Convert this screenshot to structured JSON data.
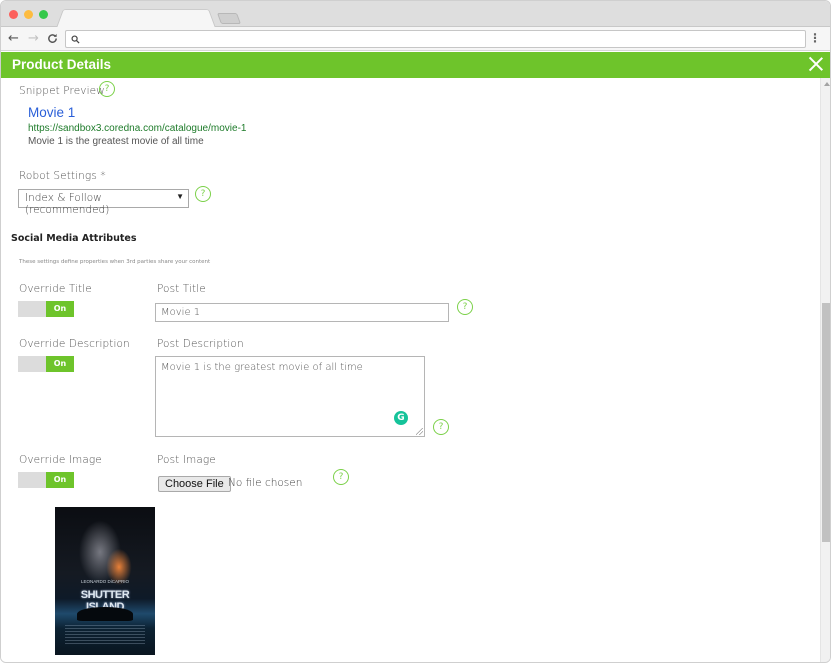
{
  "browser": {
    "tab_title": "",
    "address": "",
    "icons": {
      "back": "arrow-left-icon",
      "forward": "arrow-right-icon",
      "reload": "reload-icon",
      "search": "search-icon",
      "menu": "vertical-dots-icon"
    },
    "glyphs": {
      "back": "←",
      "forward": "→",
      "reload": "C",
      "search": "⚲",
      "menu": "⋮"
    }
  },
  "panel": {
    "title": "Product Details",
    "close_glyph": "",
    "accent_color": "#6ec42b"
  },
  "snippet": {
    "label": "Snippet Preview",
    "title": "Movie 1",
    "url": "https://sandbox3.coredna.com/catalogue/movie-1",
    "description": "Movie 1 is the greatest movie of all time"
  },
  "robot": {
    "label": "Robot Settings *",
    "selected": "Index & Follow (recommended)",
    "arrow": "▼"
  },
  "social": {
    "heading": "Social Media Attributes",
    "subheading": "These settings define properties when 3rd parties share your content",
    "override_title": {
      "label": "Override Title",
      "toggle": "On",
      "state": true
    },
    "post_title": {
      "label": "Post Title",
      "value": "Movie 1"
    },
    "override_description": {
      "label": "Override Description",
      "toggle": "On",
      "state": true
    },
    "post_description": {
      "label": "Post Description",
      "value": "Movie 1 is the greatest movie of all time"
    },
    "override_image": {
      "label": "Override Image",
      "toggle": "On",
      "state": true
    },
    "post_image": {
      "label": "Post Image",
      "button": "Choose File",
      "status": "No file chosen"
    },
    "poster": {
      "actor": "LEONARDO DiCAPRIO",
      "title": "SHUTTER ISLAND"
    }
  },
  "help_glyph": "?",
  "grammarly_glyph": "G"
}
